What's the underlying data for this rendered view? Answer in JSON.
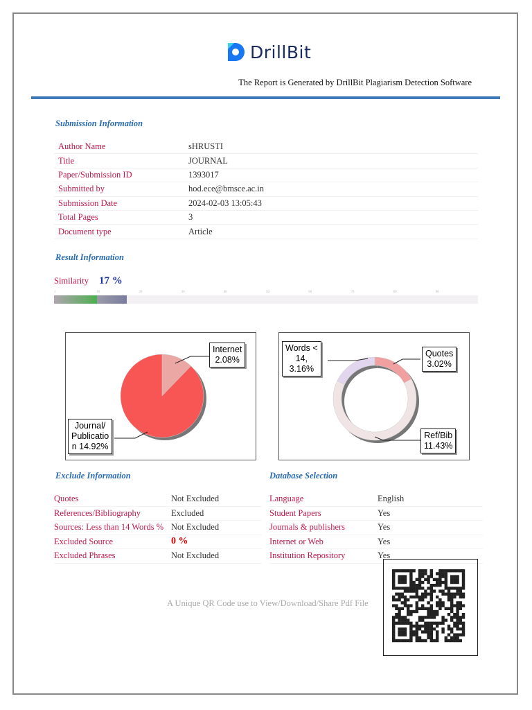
{
  "header": {
    "logo_text": "DrillBit",
    "subtitle": "The Report is Generated by DrillBit Plagiarism Detection Software"
  },
  "submission": {
    "heading": "Submission Information",
    "rows": [
      {
        "label": "Author Name",
        "value": "sHRUSTI"
      },
      {
        "label": "Title",
        "value": "JOURNAL"
      },
      {
        "label": "Paper/Submission ID",
        "value": "1393017"
      },
      {
        "label": "Submitted by",
        "value": "hod.ece@bmsce.ac.in"
      },
      {
        "label": "Submission Date",
        "value": "2024-02-03 13:05:43"
      },
      {
        "label": "Total Pages",
        "value": "3"
      },
      {
        "label": "Document type",
        "value": "Article"
      }
    ]
  },
  "result": {
    "heading": "Result Information",
    "similarity_label": "Similarity",
    "similarity_value": "17 %",
    "similarity_percent": 17,
    "ticks": [
      "1",
      "10",
      "20",
      "30",
      "40",
      "50",
      "60",
      "70",
      "80",
      "90"
    ]
  },
  "chart_data": [
    {
      "type": "pie",
      "slices": [
        {
          "label": "Internet",
          "value": 2.08,
          "text": "Internet 2.08%",
          "color": "#eba7a3"
        },
        {
          "label": "Journal/ Publication",
          "value": 14.92,
          "text": "Journal/ Publicatio n 14.92%",
          "color": "#f85555"
        }
      ]
    },
    {
      "type": "pie",
      "donut": true,
      "slices": [
        {
          "label": "Quotes",
          "value": 3.02,
          "text": "Quotes 3.02%",
          "color": "#f0a0a0"
        },
        {
          "label": "Ref/Bib",
          "value": 11.43,
          "text": "Ref/Bib 11.43%",
          "color": "#f1e4e4"
        },
        {
          "label": "Words < 14",
          "value": 3.16,
          "text": "Words < 14, 3.16%",
          "color": "#e2d6ee"
        }
      ]
    }
  ],
  "chart_labels": {
    "internet": [
      "Internet",
      "2.08%"
    ],
    "journal": [
      "Journal/",
      "Publicatio",
      "n 14.92%"
    ],
    "words": [
      "Words <",
      "14,",
      "3.16%"
    ],
    "quotes": [
      "Quotes",
      "3.02%"
    ],
    "refbib": [
      "Ref/Bib",
      "11.43%"
    ]
  },
  "exclude": {
    "heading": "Exclude Information",
    "rows": [
      {
        "label": "Quotes",
        "value": "Not Excluded"
      },
      {
        "label": "References/Bibliography",
        "value": "Excluded"
      },
      {
        "label": "Sources: Less than 14 Words %",
        "value": "Not Excluded"
      },
      {
        "label": "Excluded Source",
        "value": "0 %"
      },
      {
        "label": "Excluded Phrases",
        "value": "Not Excluded"
      }
    ]
  },
  "database": {
    "heading": "Database Selection",
    "rows": [
      {
        "label": "Language",
        "value": "English"
      },
      {
        "label": "Student Papers",
        "value": "Yes"
      },
      {
        "label": "Journals & publishers",
        "value": "Yes"
      },
      {
        "label": "Internet or Web",
        "value": "Yes"
      },
      {
        "label": "Institution Repository",
        "value": "Yes"
      }
    ]
  },
  "qr": {
    "caption": "A Unique QR Code use to View/Download/Share Pdf File"
  }
}
